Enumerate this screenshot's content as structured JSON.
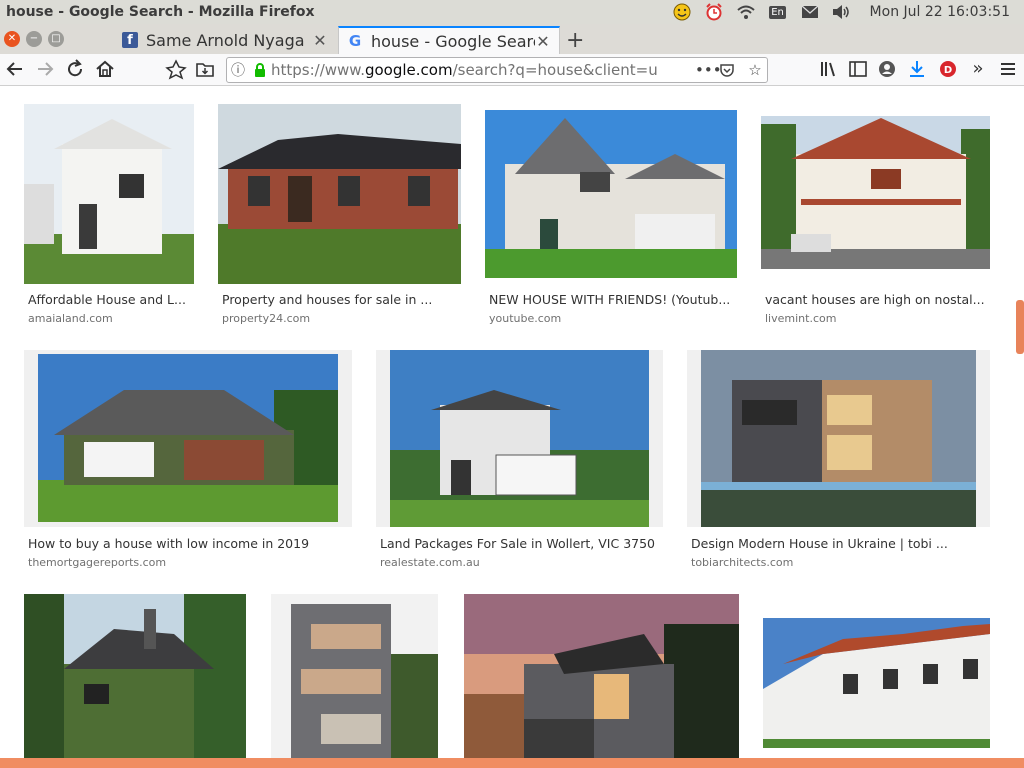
{
  "os_panel": {
    "window_title": "house - Google Search - Mozilla Firefox",
    "lang": "En",
    "clock": "Mon Jul 22 16:03:51"
  },
  "tabs": [
    {
      "label": "Same Arnold Nyaga",
      "favicon": "facebook-icon"
    },
    {
      "label": "house - Google Search",
      "favicon": "google-icon"
    }
  ],
  "urlbar": {
    "prefix": "https://www.",
    "domain": "google.com",
    "path": "/search?q=house&client=u"
  },
  "results": [
    {
      "caption": "Affordable House and L...",
      "source": "amaialand.com"
    },
    {
      "caption": "Property and houses for sale in ...",
      "source": "property24.com"
    },
    {
      "caption": "NEW HOUSE WITH FRIENDS! (Youtub...",
      "source": "youtube.com"
    },
    {
      "caption": "vacant houses are high on nostal...",
      "source": "livemint.com"
    },
    {
      "caption": "How to buy a house with low income in 2019",
      "source": "themortgagereports.com"
    },
    {
      "caption": "Land Packages For Sale in Wollert, VIC 3750",
      "source": "realestate.com.au"
    },
    {
      "caption": "Design Modern House in Ukraine | tobi ...",
      "source": "tobiarchitects.com"
    },
    {
      "caption": "",
      "source": ""
    },
    {
      "caption": "",
      "source": ""
    },
    {
      "caption": "",
      "source": ""
    },
    {
      "caption": "",
      "source": ""
    }
  ],
  "colors": {
    "accent": "#e95420",
    "tab_highlight": "#0a84ff",
    "scroll": "#e8835a"
  }
}
